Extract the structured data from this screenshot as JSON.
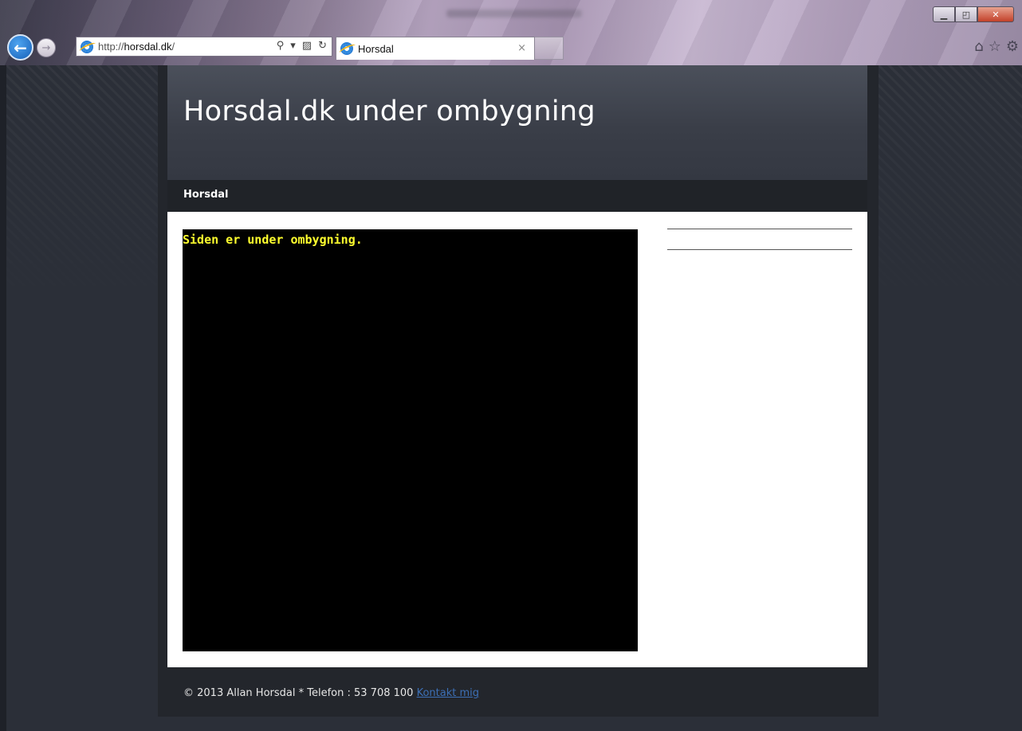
{
  "browser": {
    "address_prefix": "http://",
    "address_host": "horsdal.dk",
    "address_suffix": "/",
    "tab_title": "Horsdal",
    "tab_close": "×",
    "search_icon": "⚲",
    "dropdown_icon": "▾",
    "compat_icon": "▨",
    "refresh_icon": "↻",
    "home_icon": "⌂",
    "favorites_icon": "☆",
    "tools_icon": "⚙",
    "minimize_icon": "▁",
    "restore_icon": "◰",
    "close_icon": "✕",
    "back_icon": "←",
    "forward_icon": "→"
  },
  "site": {
    "title": "Horsdal.dk under ombygning",
    "menu": [
      "Horsdal"
    ],
    "notice": "Siden er under ombygning.",
    "footer_text": "© 2013 Allan Horsdal * Telefon : 53 708 100 ",
    "footer_link": "Kontakt mig"
  },
  "colors": {
    "page_bg": "#2b2f38",
    "header_bg": "#3a3e48",
    "menu_bg": "#202328",
    "notice_color": "#ffff2e",
    "link_color": "#3c6fb5"
  }
}
